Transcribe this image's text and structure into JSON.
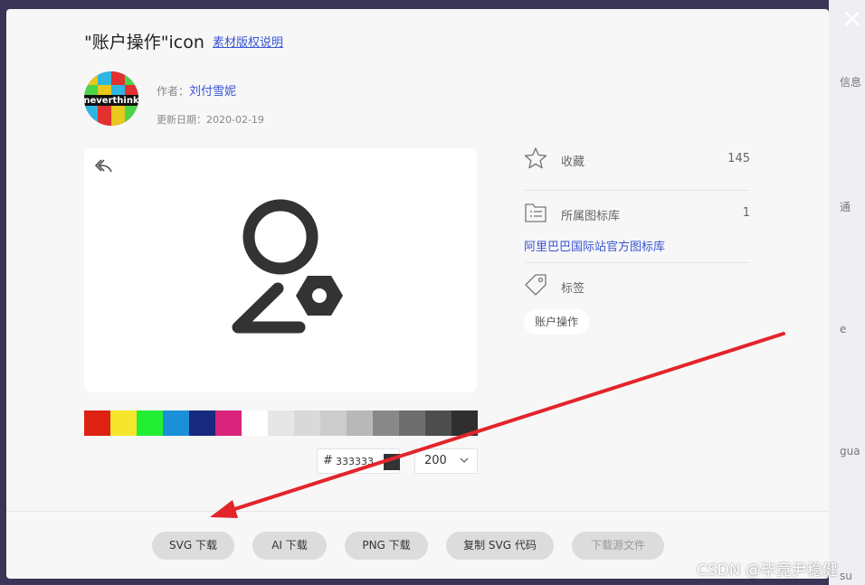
{
  "modal": {
    "title": "\"账户操作\"icon",
    "copyright_link": "素材版权说明",
    "close_glyph": "✕",
    "avatar_text": "neverthink",
    "author_label": "作者：",
    "author_name": "刘付雪妮",
    "update_date": "更新日期：2020-02-19"
  },
  "preview": {
    "icon_color": "#333333",
    "swatches": [
      "#dd2211",
      "#f5e52d",
      "#22ee33",
      "#1a90d8",
      "#182a7e",
      "#d8237d",
      "#ffffff",
      "#e6e6e6",
      "#d9d9d9",
      "#cccccc",
      "#b8b8b8",
      "#888888",
      "#6e6e6e",
      "#4d4d4d",
      "#2f2f2f"
    ],
    "hex_hash": "#",
    "hex_value": "333333",
    "size_value": "200"
  },
  "side": {
    "collect_label": "收藏",
    "collect_count": "145",
    "library_label": "所属图标库",
    "library_count": "1",
    "library_link": "阿里巴巴国际站官方图标库",
    "tag_label": "标签",
    "tag_item": "账户操作"
  },
  "buttons": {
    "svg_download": "SVG 下载",
    "ai_download": "AI 下载",
    "png_download": "PNG 下载",
    "copy_svg": "复制 SVG 代码",
    "source_download": "下载源文件"
  },
  "background": {
    "snippets": [
      "信息",
      "通",
      "e",
      "gua",
      "su"
    ]
  },
  "annotation": {
    "arrow_color": "#e3242b"
  },
  "watermark": "CSDN @毕竟尹稳健"
}
